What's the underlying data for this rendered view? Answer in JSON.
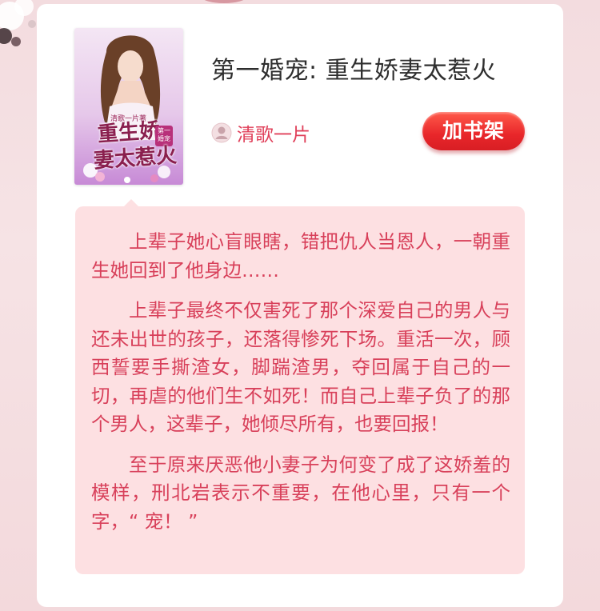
{
  "book": {
    "title": "第一婚宠: 重生娇妻太惹火",
    "author": "清歌一片",
    "add_to_shelf_label": "加书架"
  },
  "cover": {
    "author_text": "清歌一片著",
    "title_line1": "重生娇",
    "title_line2": "妻太惹火",
    "badge_text": "第一婚宠"
  },
  "synopsis": {
    "paragraphs": [
      "上辈子她心盲眼瞎，错把仇人当恩人，一朝重生她回到了他身边……",
      "上辈子最终不仅害死了那个深爱自己的男人与还未出世的孩子，还落得惨死下场。重活一次，顾西誓要手撕渣女，脚踹渣男，夺回属于自己的一切，再虐的他们生不如死！而自己上辈子负了的那个男人，这辈子，她倾尽所有，也要回报！",
      "至于原来厌恶他小妻子为何变了成了这娇羞的模样，刑北岩表示不重要，在他心里，只有一个字，“ 宠！ ”"
    ]
  },
  "icons": {
    "author": "user-avatar-icon"
  },
  "colors": {
    "accent": "#e0405a",
    "button": "#e8262a",
    "synopsis_bg": "#fde0e2",
    "synopsis_text": "#d8405a",
    "page_bg": "#f3dcdf"
  }
}
